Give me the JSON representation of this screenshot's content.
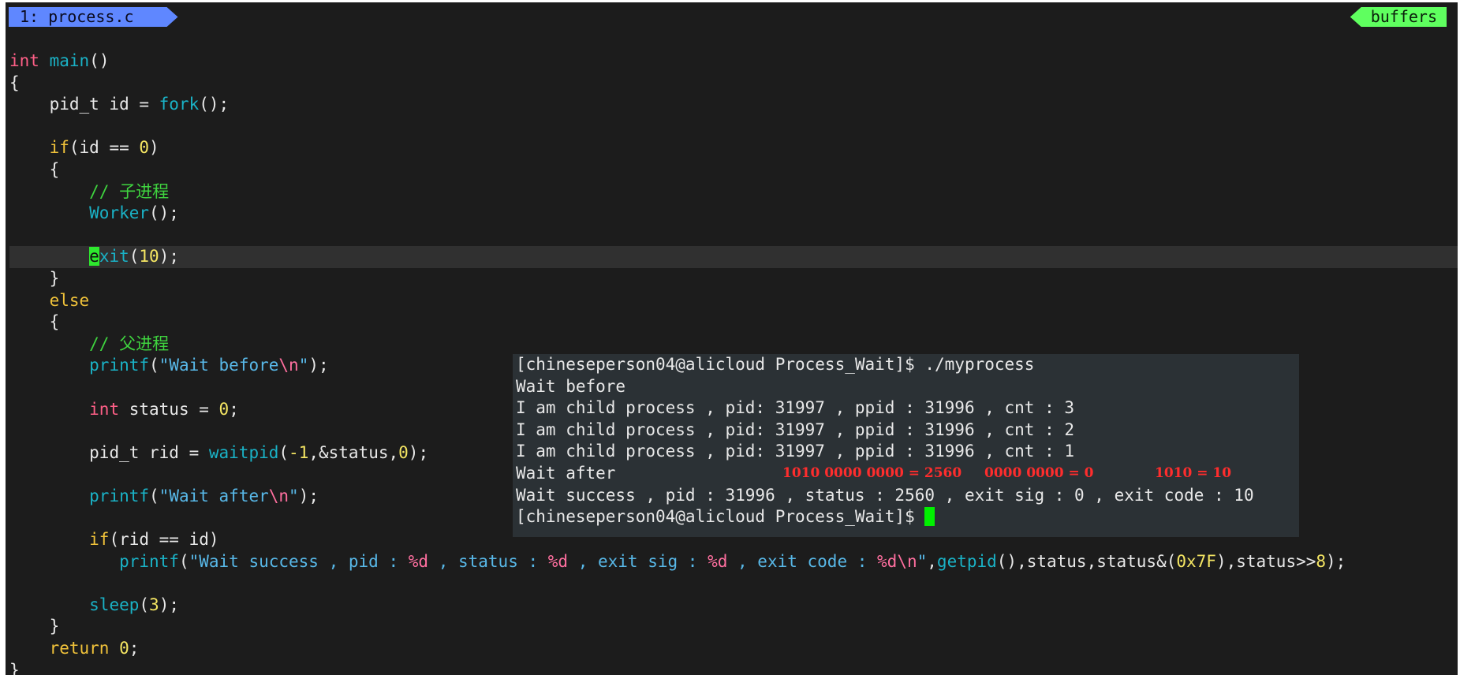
{
  "tabline": {
    "file_tab": "1: process.c",
    "buffers_label": "buffers"
  },
  "code": {
    "l1_type": "int",
    "l1_fn": "main",
    "l1_rest": "()",
    "l2": "{",
    "l3_pre": "    pid_t id = ",
    "l3_fn": "fork",
    "l3_post": "();",
    "l5_kw": "if",
    "l5_mid": "(id == ",
    "l5_num": "0",
    "l5_post": ")",
    "l6": "    {",
    "l7_comment": "// 子进程",
    "l8_fn": "Worker",
    "l8_post": "();",
    "l10_cursor": "e",
    "l10_fn": "xit",
    "l10_open": "(",
    "l10_num": "10",
    "l10_post": ");",
    "l11": "    }",
    "l12_kw": "else",
    "l13": "    {",
    "l14_comment": "// 父进程",
    "l15_fn": "printf",
    "l15_open": "(",
    "l15_str": "\"Wait before",
    "l15_esc": "\\n",
    "l15_strend": "\"",
    "l15_post": ");",
    "l17_type": "int",
    "l17_mid": " status = ",
    "l17_num": "0",
    "l17_post": ";",
    "l19_pre": "pid_t rid = ",
    "l19_fn": "waitpid",
    "l19_open": "(",
    "l19_num1": "-1",
    "l19_mid": ",&status,",
    "l19_num2": "0",
    "l19_post": ");",
    "l21_fn": "printf",
    "l21_open": "(",
    "l21_str": "\"Wait after",
    "l21_esc": "\\n",
    "l21_strend": "\"",
    "l21_post": ");",
    "l23_kw": "if",
    "l23_post": "(rid == id)",
    "l24_fn": "printf",
    "l24_open": "(",
    "l24_s1": "\"Wait success , pid : ",
    "l24_f1": "%d",
    "l24_s2": " , status : ",
    "l24_f2": "%d",
    "l24_s3": " , exit sig : ",
    "l24_f3": "%d",
    "l24_s4": " , exit code : ",
    "l24_f4": "%d\\n",
    "l24_s5": "\"",
    "l24_c1": ",",
    "l24_fn2": "getpid",
    "l24_c2": "(),status,status&(",
    "l24_hex": "0x7F",
    "l24_c3": "),status>>",
    "l24_num": "8",
    "l24_end": ");",
    "l26_fn": "sleep",
    "l26_open": "(",
    "l26_num": "3",
    "l26_post": ");",
    "l27": "    }",
    "l28_kw": "return",
    "l28_num": "0",
    "l28_post": ";",
    "l29": "}"
  },
  "terminal": {
    "lines": [
      "[chineseperson04@alicloud Process_Wait]$ ./myprocess",
      "Wait before",
      "I am child process , pid: 31997 , ppid : 31996 , cnt : 3",
      "I am child process , pid: 31997 , ppid : 31996 , cnt : 2",
      "I am child process , pid: 31997 , ppid : 31996 , cnt : 1",
      "Wait after",
      "Wait success , pid : 31996 , status : 2560 , exit sig : 0 , exit code : 10",
      "[chineseperson04@alicloud Process_Wait]$ "
    ],
    "annotations": [
      "1010 0000 0000 = 2560",
      "0000 0000 = 0",
      "1010 = 10"
    ]
  }
}
